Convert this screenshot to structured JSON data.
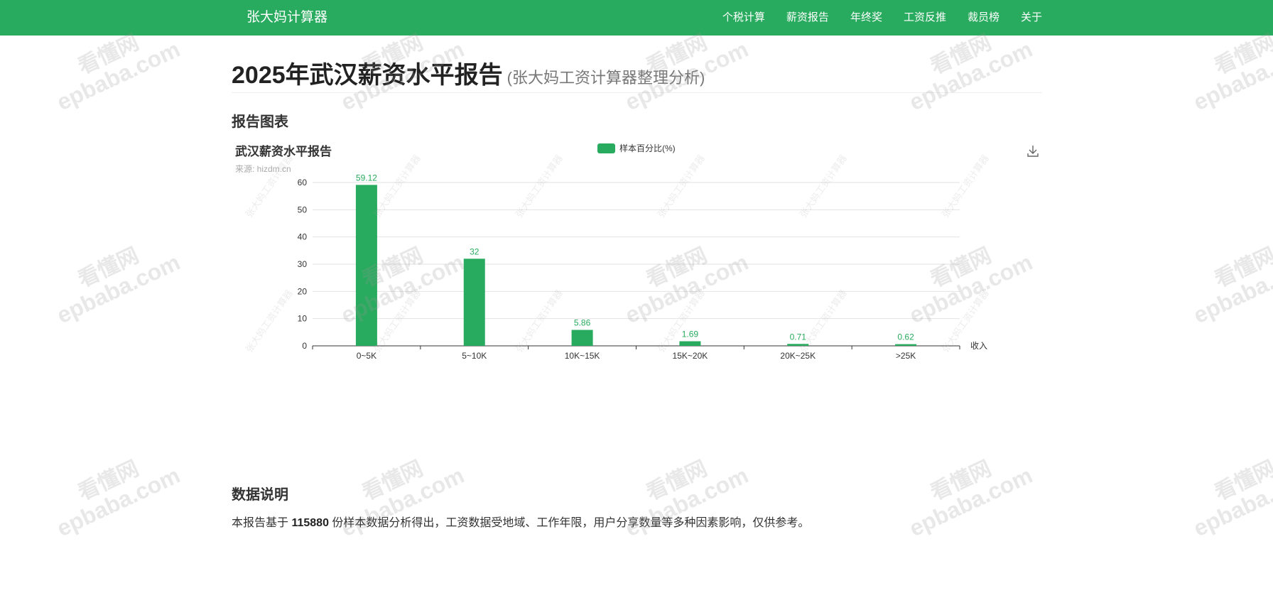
{
  "navbar": {
    "brand": "张大妈计算器",
    "links": [
      "个税计算",
      "薪资报告",
      "年终奖",
      "工资反推",
      "裁员榜",
      "关于"
    ]
  },
  "page": {
    "title": "2025年武汉薪资水平报告",
    "subtitle": "(张大妈工资计算器整理分析)"
  },
  "chart_section": {
    "heading": "报告图表"
  },
  "chart": {
    "title": "武汉薪资水平报告",
    "source": "来源: hizdm.cn",
    "legend": "样本百分比(%)",
    "download_icon": "download-icon"
  },
  "chart_data": {
    "type": "bar",
    "title": "武汉薪资水平报告",
    "categories": [
      "0~5K",
      "5~10K",
      "10K~15K",
      "15K~20K",
      "20K~25K",
      ">25K"
    ],
    "series": [
      {
        "name": "样本百分比(%)",
        "values": [
          59.12,
          32,
          5.86,
          1.69,
          0.71,
          0.62
        ]
      }
    ],
    "xlabel": "收入",
    "ylabel": "",
    "ylim": [
      0,
      60
    ],
    "yticks": [
      "0",
      "10",
      "20",
      "30",
      "40",
      "50",
      "60"
    ],
    "grid": true,
    "legend_position": "top-center",
    "color": "#28ab5e"
  },
  "data_section": {
    "heading": "数据说明",
    "prefix": "本报告基于 ",
    "count": "115880",
    "suffix": " 份样本数据分析得出，工资数据受地域、工作年限，用户分享数量等多种因素影响，仅供参考。"
  },
  "watermark": {
    "line1": "看懂网",
    "line2": "epbaba.com",
    "chart_line": "张大妈工资计算器"
  },
  "colors": {
    "brand": "#28ab5e",
    "text": "#333333",
    "muted": "#777777"
  }
}
